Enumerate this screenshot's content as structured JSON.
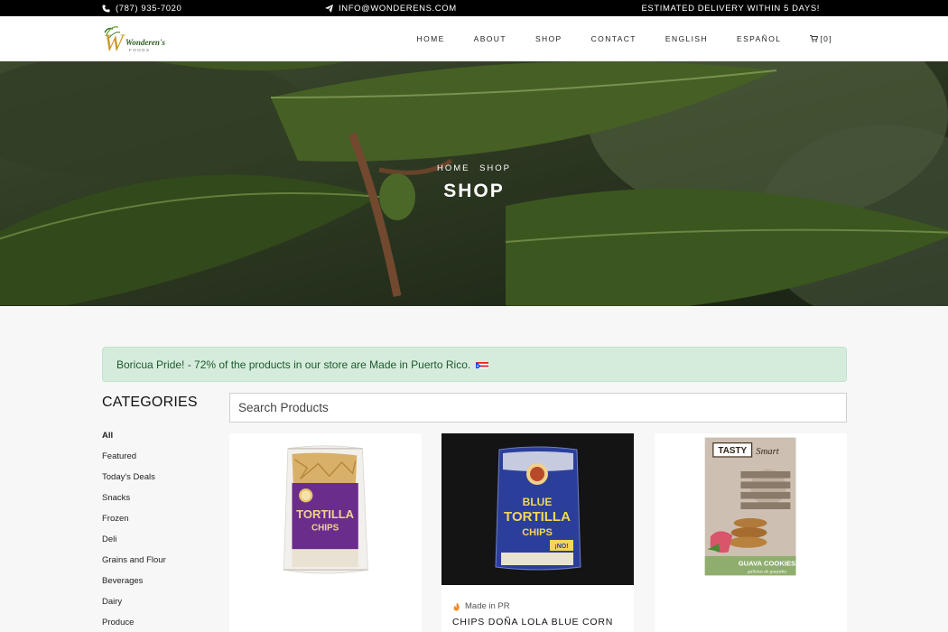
{
  "topbar": {
    "phone": "(787) 935-7020",
    "email": "INFO@WONDERENS.COM",
    "delivery": "ESTIMATED DELIVERY WITHIN 5 DAYS!"
  },
  "brand": {
    "logo_text": "Wonderen's",
    "logo_subtext": "FOODS",
    "logo_letter": "W"
  },
  "nav": {
    "items": [
      "HOME",
      "ABOUT",
      "SHOP",
      "CONTACT",
      "ENGLISH",
      "ESPAÑOL"
    ],
    "cart_label": "[0]"
  },
  "hero": {
    "breadcrumbs": [
      "HOME",
      "SHOP"
    ],
    "title": "SHOP"
  },
  "alert": {
    "message": "Boricua Pride! - 72% of the products in our store are Made in Puerto Rico."
  },
  "categories": {
    "title": "CATEGORIES",
    "items": [
      "All",
      "Featured",
      "Today's Deals",
      "Snacks",
      "Frozen",
      "Deli",
      "Grains and Flour",
      "Beverages",
      "Dairy",
      "Produce"
    ],
    "active": "All"
  },
  "search": {
    "placeholder": "Search Products",
    "value": ""
  },
  "products": [
    {
      "package_brand": "",
      "package_line1": "TORTILLA",
      "package_line2": "CHIPS"
    },
    {
      "origin": "Made in PR",
      "name": "CHIPS DOÑA LOLA BLUE CORN",
      "package_line1": "BLUE",
      "package_line2": "TORTILLA",
      "package_line3": "CHIPS",
      "package_badge": "¡NO!"
    },
    {
      "package_brand": "TASTY",
      "package_brand2": "Smart",
      "package_name": "GUAVA COOKIES",
      "package_sub": "galletas de guayaba"
    }
  ],
  "colors": {
    "topbar_bg": "#000000",
    "alert_bg": "#d5ecdc",
    "alert_text": "#1e5a2e",
    "brand_green": "#3a7a2a",
    "brand_gold": "#c89a2a"
  },
  "icons": {
    "phone": "phone-icon",
    "email": "paper-plane-icon",
    "cart": "cart-icon",
    "origin": "flame-icon",
    "flag": "puerto-rico-flag-icon"
  }
}
